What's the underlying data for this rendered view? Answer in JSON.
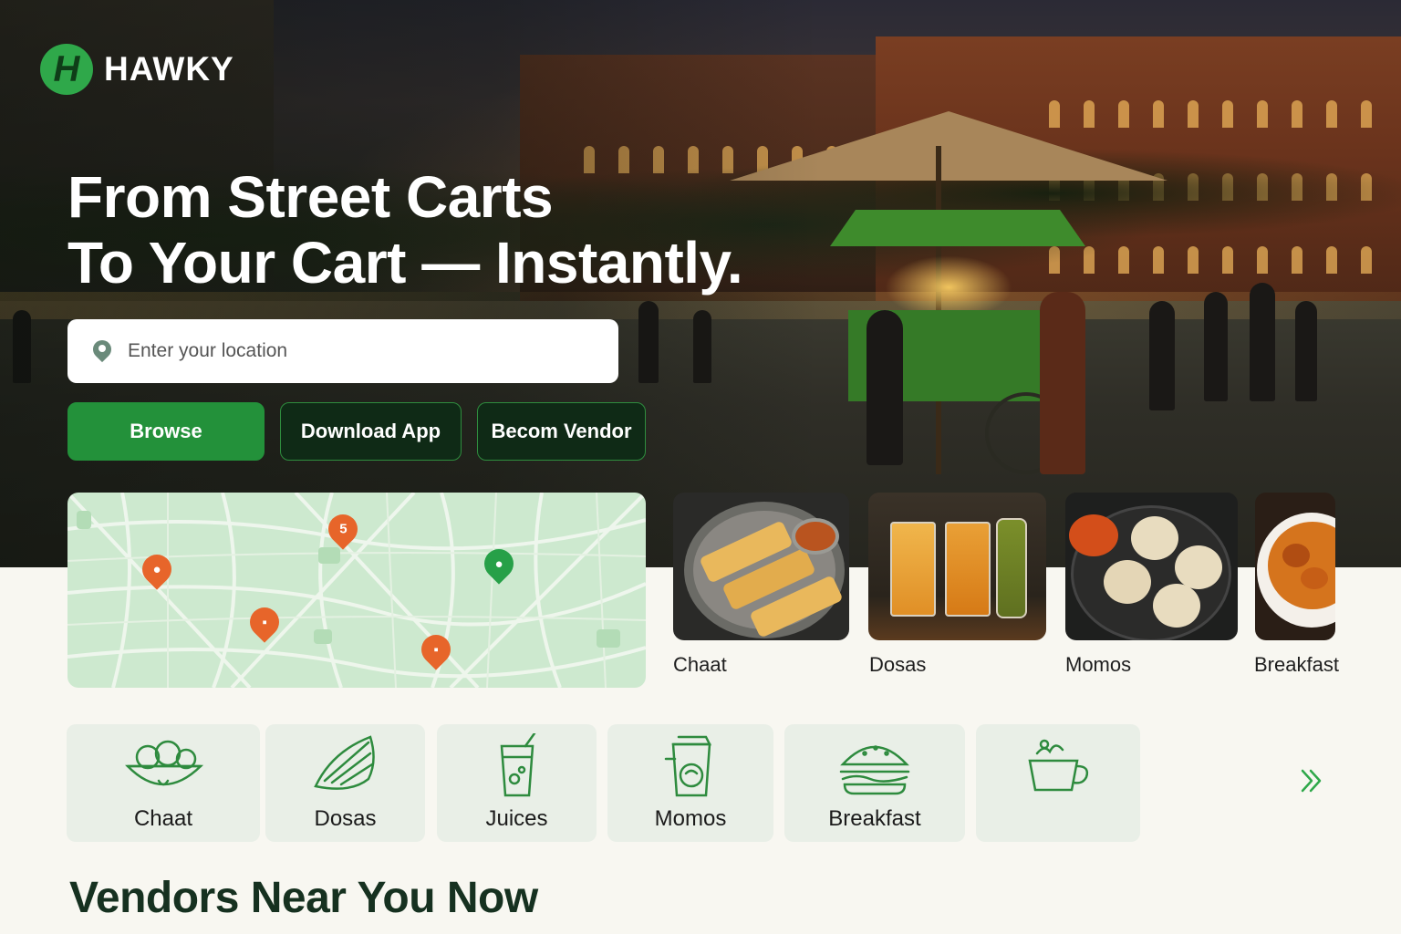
{
  "brand": {
    "name": "HAWKY",
    "logo_letter": "H"
  },
  "hero": {
    "headline_line1": "From Street Carts",
    "headline_line2": "To Your Cart — Instantly."
  },
  "search": {
    "placeholder": "Enter your location",
    "icon": "map-pin-icon"
  },
  "actions": {
    "browse": "Browse",
    "download": "Download App",
    "vendor": "Becom Vendor"
  },
  "map": {
    "markers": [
      {
        "icon": "food-marker",
        "color": "#e7652a",
        "label": ""
      },
      {
        "icon": "number-marker",
        "color": "#e7652a",
        "label": "5"
      },
      {
        "icon": "vendor-marker",
        "color": "#27a048",
        "label": ""
      },
      {
        "icon": "food-marker",
        "color": "#e7652a",
        "label": ""
      },
      {
        "icon": "food-marker",
        "color": "#e7652a",
        "label": ""
      }
    ]
  },
  "featured": [
    {
      "label": "Chaat"
    },
    {
      "label": "Dosas"
    },
    {
      "label": "Momos"
    },
    {
      "label": "Breakfast"
    }
  ],
  "categories": [
    {
      "label": "Chaat",
      "icon": "chaat-bowl-icon"
    },
    {
      "label": "Dosas",
      "icon": "dosa-icon"
    },
    {
      "label": "Juices",
      "icon": "juice-glass-icon"
    },
    {
      "label": "Momos",
      "icon": "momo-icon"
    },
    {
      "label": "Breakfast",
      "icon": "burger-icon"
    },
    {
      "label": "",
      "icon": "tea-cup-icon"
    }
  ],
  "section": {
    "title": "Vendors Near You Now"
  },
  "colors": {
    "brand_green": "#23913a",
    "dark_green": "#0f2a16",
    "marker_orange": "#e7652a",
    "background": "#f8f7f1"
  }
}
